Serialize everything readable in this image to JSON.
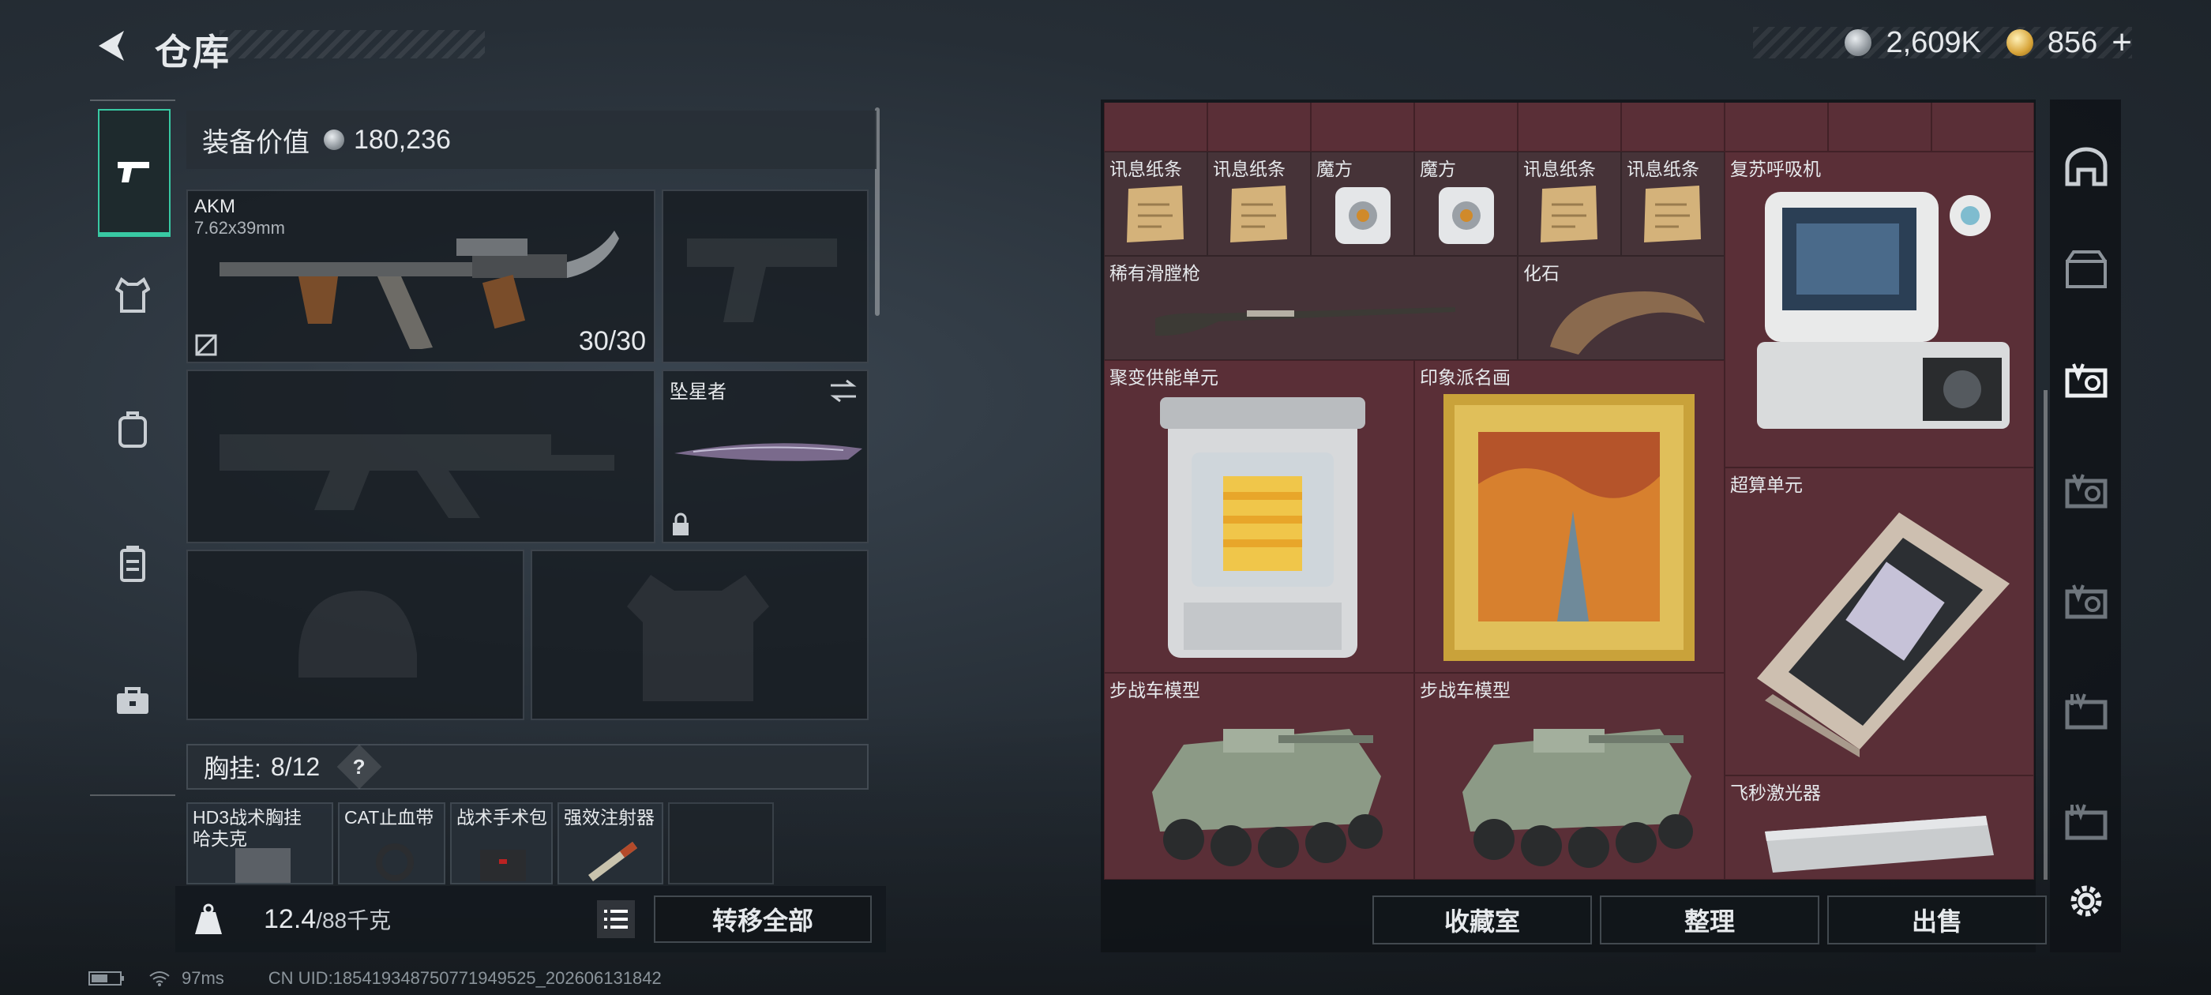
{
  "header": {
    "title": "仓库",
    "currency_silver": "2,609K",
    "currency_gold": "856"
  },
  "loadout": {
    "value_label": "装备价值",
    "value": "180,236",
    "primary": {
      "name": "AKM",
      "caliber": "7.62x39mm",
      "ammo": "30/30"
    },
    "melee": {
      "name": "坠星者"
    },
    "chest_rig": {
      "label": "胸挂:",
      "count": "8/12",
      "help": "?"
    },
    "chest_items": [
      {
        "name": "HD3战术胸挂\n哈夫克"
      },
      {
        "name": "CAT止血带"
      },
      {
        "name": "战术手术包"
      },
      {
        "name": "强效注射器"
      }
    ],
    "weight": {
      "value": "12.4",
      "max": "/88千克"
    },
    "transfer_all": "转移全部"
  },
  "stash": {
    "items": [
      {
        "name": "讯息纸条"
      },
      {
        "name": "讯息纸条"
      },
      {
        "name": "魔方"
      },
      {
        "name": "魔方"
      },
      {
        "name": "讯息纸条"
      },
      {
        "name": "讯息纸条"
      },
      {
        "name": "复苏呼吸机"
      },
      {
        "name": "稀有滑膛枪"
      },
      {
        "name": "化石"
      },
      {
        "name": "聚变供能单元"
      },
      {
        "name": "印象派名画"
      },
      {
        "name": "超算单元"
      },
      {
        "name": "步战车模型"
      },
      {
        "name": "步战车模型"
      },
      {
        "name": "飞秒激光器"
      }
    ],
    "buttons": {
      "collection": "收藏室",
      "sort": "整理",
      "sell": "出售"
    }
  },
  "status_bar": {
    "ping": "97ms",
    "uid": "CN UID:185419348750771949525_202606131842"
  },
  "colors": {
    "accent": "#38c9a3",
    "stash_bg": "#5a2f37"
  }
}
